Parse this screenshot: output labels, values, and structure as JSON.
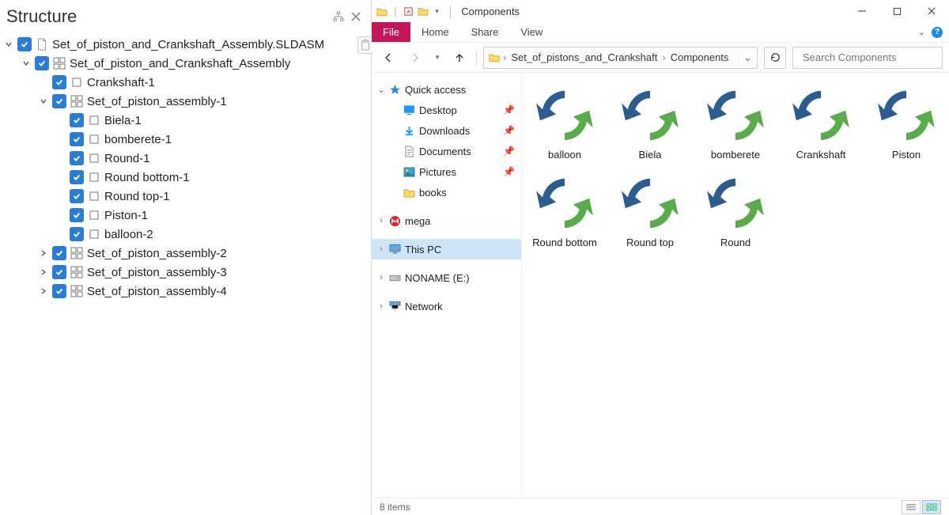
{
  "left_panel": {
    "title": "Structure",
    "tree": [
      {
        "depth": 0,
        "exp": "down",
        "type": "doc",
        "label": "Set_of_piston_and_Crankshaft_Assembly.SLDASM"
      },
      {
        "depth": 1,
        "exp": "down",
        "type": "asm",
        "label": "Set_of_piston_and_Crankshaft_Assembly"
      },
      {
        "depth": 2,
        "exp": "none",
        "type": "part",
        "label": "Crankshaft-1"
      },
      {
        "depth": 2,
        "exp": "down",
        "type": "asm",
        "label": "Set_of_piston_assembly-1"
      },
      {
        "depth": 3,
        "exp": "none",
        "type": "part",
        "label": "Biela-1"
      },
      {
        "depth": 3,
        "exp": "none",
        "type": "part",
        "label": "bomberete-1"
      },
      {
        "depth": 3,
        "exp": "none",
        "type": "part",
        "label": "Round-1"
      },
      {
        "depth": 3,
        "exp": "none",
        "type": "part",
        "label": "Round bottom-1"
      },
      {
        "depth": 3,
        "exp": "none",
        "type": "part",
        "label": "Round top-1"
      },
      {
        "depth": 3,
        "exp": "none",
        "type": "part",
        "label": "Piston-1"
      },
      {
        "depth": 3,
        "exp": "none",
        "type": "part",
        "label": "balloon-2"
      },
      {
        "depth": 2,
        "exp": "right",
        "type": "asm",
        "label": "Set_of_piston_assembly-2"
      },
      {
        "depth": 2,
        "exp": "right",
        "type": "asm",
        "label": "Set_of_piston_assembly-3"
      },
      {
        "depth": 2,
        "exp": "right",
        "type": "asm",
        "label": "Set_of_piston_assembly-4"
      }
    ]
  },
  "explorer": {
    "window_title": "Components",
    "ribbon": {
      "file": "File",
      "home": "Home",
      "share": "Share",
      "view": "View"
    },
    "breadcrumb": [
      "Set_of_pistons_and_Crankshaft",
      "Components"
    ],
    "search_placeholder": "Search Components",
    "navpane": [
      {
        "exp": "down",
        "icon": "star",
        "label": "Quick access",
        "depth": 0
      },
      {
        "exp": "none",
        "icon": "desktop",
        "label": "Desktop",
        "depth": 1,
        "pin": true
      },
      {
        "exp": "none",
        "icon": "download",
        "label": "Downloads",
        "depth": 1,
        "pin": true
      },
      {
        "exp": "none",
        "icon": "document",
        "label": "Documents",
        "depth": 1,
        "pin": true
      },
      {
        "exp": "none",
        "icon": "pictures",
        "label": "Pictures",
        "depth": 1,
        "pin": true
      },
      {
        "exp": "none",
        "icon": "folder",
        "label": "books",
        "depth": 1
      },
      {
        "exp": "right",
        "icon": "mega",
        "label": "mega",
        "depth": 0,
        "gap": true
      },
      {
        "exp": "right",
        "icon": "thispc",
        "label": "This PC",
        "depth": 0,
        "gap": true,
        "selected": true
      },
      {
        "exp": "right",
        "icon": "drive",
        "label": "NONAME (E:)",
        "depth": 0,
        "gap": true
      },
      {
        "exp": "right",
        "icon": "network",
        "label": "Network",
        "depth": 0,
        "gap": true
      }
    ],
    "files": [
      "balloon",
      "Biela",
      "bomberete",
      "Crankshaft",
      "Piston",
      "Round bottom",
      "Round top",
      "Round"
    ],
    "status": "8 items"
  }
}
